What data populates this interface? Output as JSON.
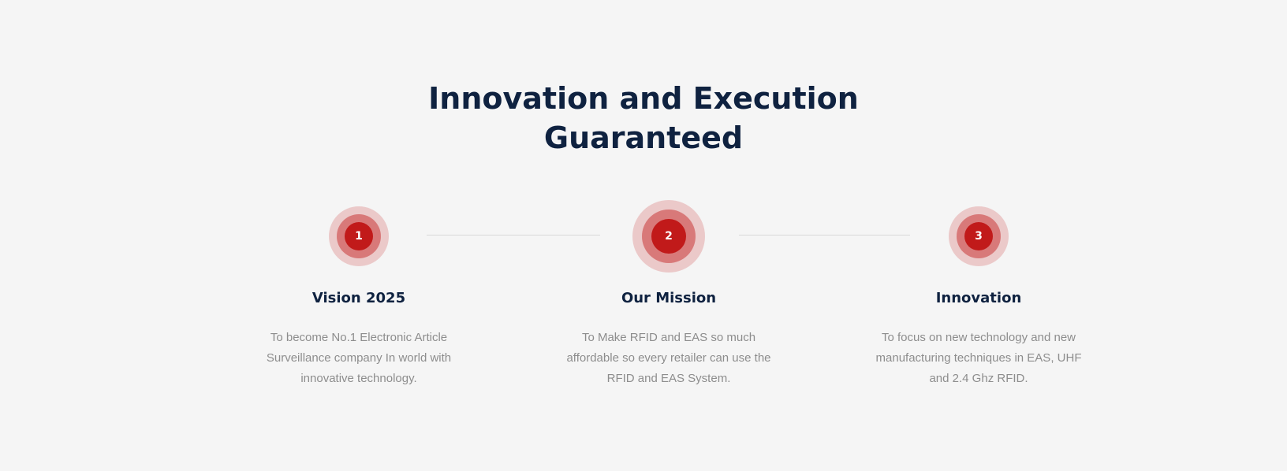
{
  "section": {
    "title_line1": "Innovation and Execution",
    "title_line2": "Guaranteed",
    "colors": {
      "background": "#f5f5f5",
      "heading": "#0f2240",
      "accent": "#c11a1a",
      "body_text": "#8d8d8d",
      "connector": "#d9d9d9"
    }
  },
  "steps": [
    {
      "number": "1",
      "title": "Vision 2025",
      "desc": "To become No.1 Electronic Article Surveillance company In world with innovative technology."
    },
    {
      "number": "2",
      "title": "Our Mission",
      "desc": "To Make RFID and EAS so much affordable so every retailer can use the RFID and EAS System."
    },
    {
      "number": "3",
      "title": "Innovation",
      "desc": "To focus on new technology and new manufacturing techniques in EAS, UHF and 2.4 Ghz RFID."
    }
  ]
}
